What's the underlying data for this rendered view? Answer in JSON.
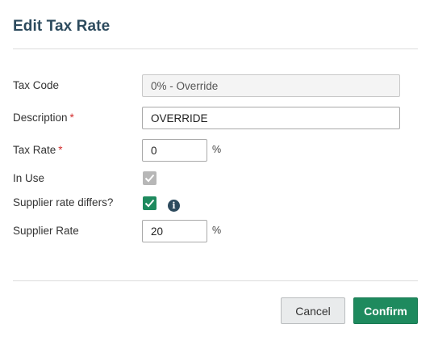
{
  "dialog": {
    "title": "Edit Tax Rate"
  },
  "fields": {
    "tax_code": {
      "label": "Tax Code",
      "value": "0% - Override"
    },
    "description": {
      "label": "Description",
      "required_mark": "*",
      "value": "OVERRIDE"
    },
    "tax_rate": {
      "label": "Tax Rate",
      "required_mark": "*",
      "value": "0",
      "unit": "%"
    },
    "in_use": {
      "label": "In Use",
      "checked": true,
      "disabled": true
    },
    "supplier_rate_differs": {
      "label": "Supplier rate differs?",
      "checked": true,
      "info_icon": "info-icon"
    },
    "supplier_rate": {
      "label": "Supplier Rate",
      "value": "20",
      "unit": "%"
    }
  },
  "actions": {
    "cancel_label": "Cancel",
    "confirm_label": "Confirm"
  },
  "colors": {
    "title": "#2d4b5e",
    "primary": "#1e8a5e",
    "required": "#d32f2f",
    "checkbox_disabled": "#b7b7b7"
  }
}
